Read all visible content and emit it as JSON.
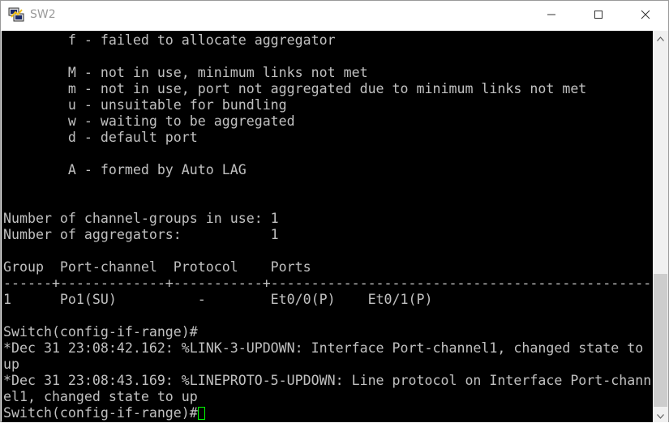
{
  "window": {
    "title": "SW2",
    "icon": "putty-icon",
    "controls": [
      "minimize-icon",
      "maximize-icon",
      "close-icon"
    ]
  },
  "terminal": {
    "lines": [
      "        f - failed to allocate aggregator",
      "",
      "        M - not in use, minimum links not met",
      "        m - not in use, port not aggregated due to minimum links not met",
      "        u - unsuitable for bundling",
      "        w - waiting to be aggregated",
      "        d - default port",
      "",
      "        A - formed by Auto LAG",
      "",
      "",
      "Number of channel-groups in use: 1",
      "Number of aggregators:           1",
      "",
      "Group  Port-channel  Protocol    Ports",
      "------+-------------+-----------+-----------------------------------------------",
      "1      Po1(SU)          -        Et0/0(P)    Et0/1(P)",
      "",
      "Switch(config-if-range)#",
      "*Dec 31 23:08:42.162: %LINK-3-UPDOWN: Interface Port-channel1, changed state to",
      "up",
      "*Dec 31 23:08:43.169: %LINEPROTO-5-UPDOWN: Line protocol on Interface Port-chann",
      "el1, changed state to up",
      "Switch(config-if-range)#"
    ],
    "colors": {
      "background": "#000000",
      "text": "#c0c0c0",
      "cursor": "#00ff00"
    }
  },
  "scrollbar": {
    "up_icon": "scroll-up-arrow-icon",
    "down_icon": "scroll-down-arrow-icon"
  }
}
